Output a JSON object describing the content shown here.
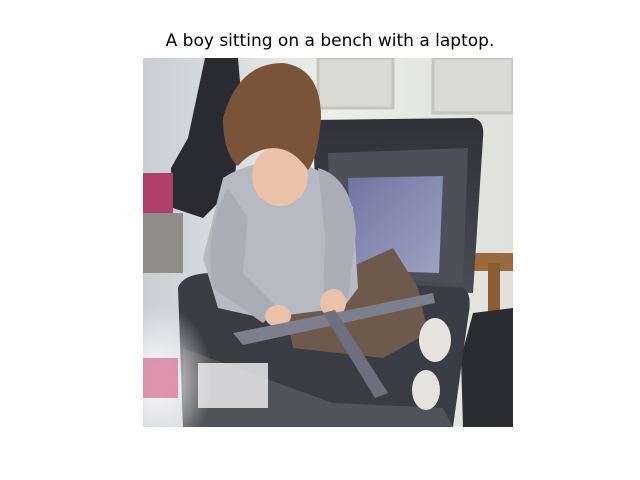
{
  "figure": {
    "caption": "A boy sitting on a bench with a laptop."
  },
  "photo": {
    "subject": "child sitting inside an open suitcase",
    "colors": {
      "wall": "#e9ebe6",
      "door_panel": "#d8d9d2",
      "suitcase": "#3b3d44",
      "suitcase_lining": "#55585f",
      "laptop_screen": "#7f84a8",
      "sweater": "#b6bac3",
      "hair": "#7a5438",
      "skin": "#e9c2a8",
      "pants": "#6e5a4d",
      "strap": "#7c7f8c",
      "bench_wood": "#9a6a3c"
    }
  }
}
